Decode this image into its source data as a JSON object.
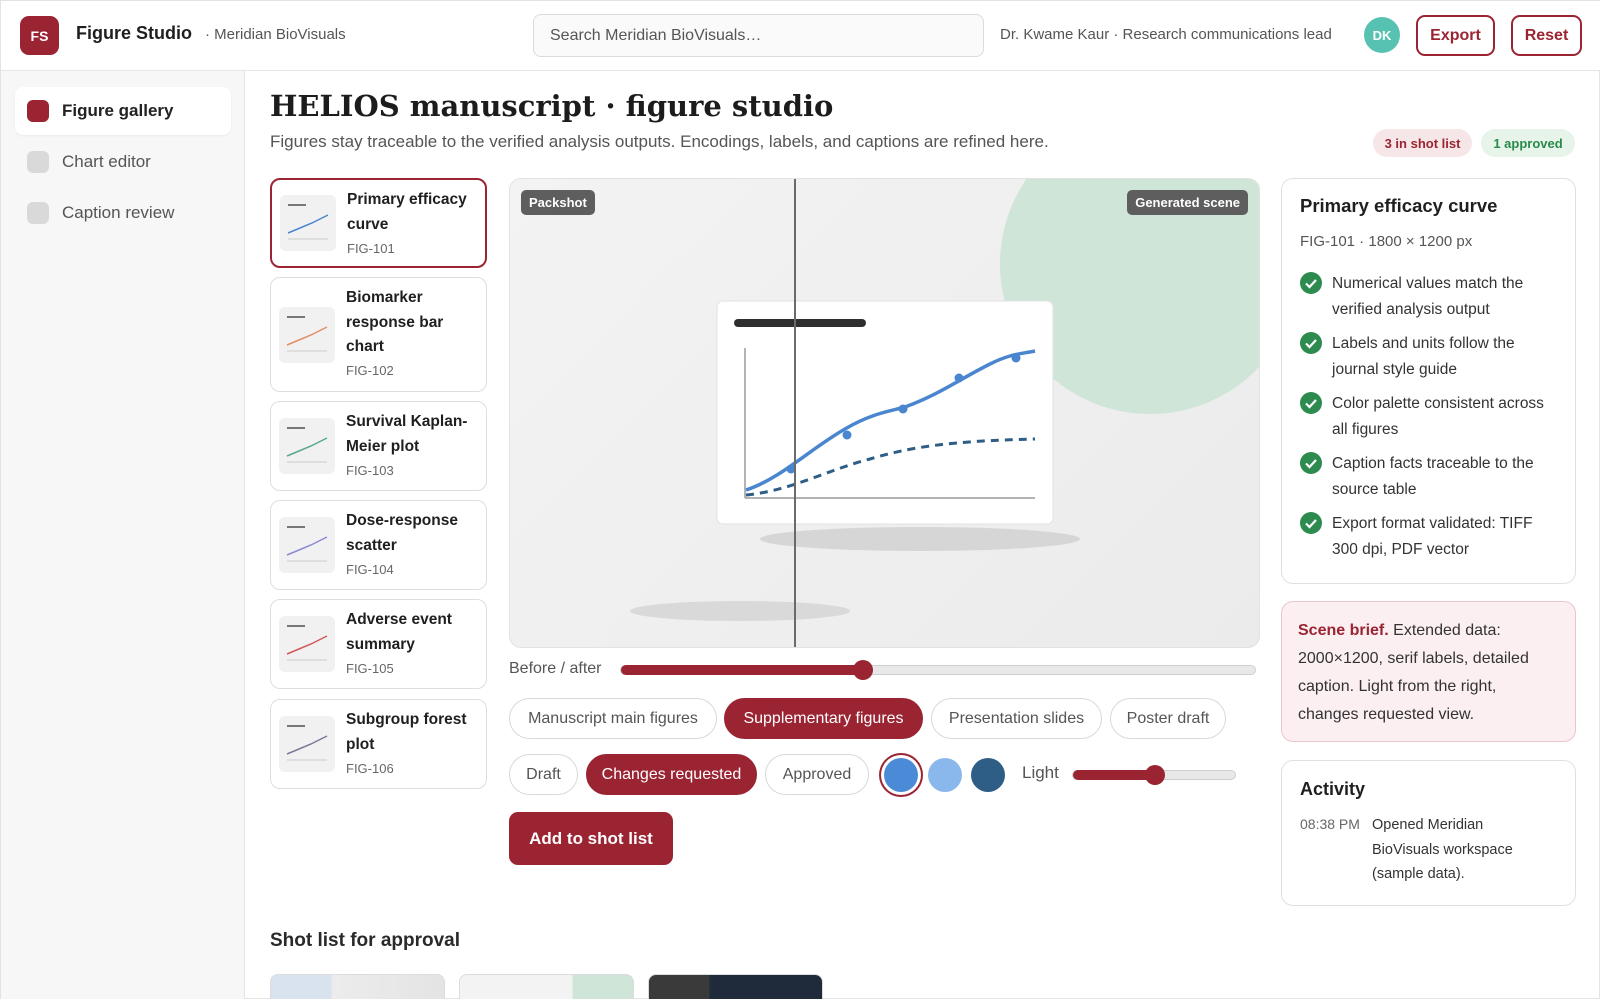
{
  "header": {
    "logo": "FS",
    "app_title": "Figure Studio",
    "workspace": "· Meridian BioVisuals",
    "search_placeholder": "Search Meridian BioVisuals…",
    "user": "Dr. Kwame Kaur · Research communications lead",
    "avatar": "DK",
    "export_label": "Export",
    "reset_label": "Reset"
  },
  "sidebar": {
    "items": [
      {
        "label": "Figure gallery",
        "active": true
      },
      {
        "label": "Chart editor",
        "active": false
      },
      {
        "label": "Caption review",
        "active": false
      }
    ]
  },
  "page": {
    "title": "HELIOS manuscript · figure studio",
    "subtitle": "Figures stay traceable to the verified analysis outputs. Encodings, labels, and captions are refined here.",
    "badge_shot": "3 in shot list",
    "badge_approved": "1 approved"
  },
  "figures": [
    {
      "name": "Primary efficacy curve",
      "id": "FIG-101",
      "color": "#4a86d0"
    },
    {
      "name": "Biomarker response bar chart",
      "id": "FIG-102",
      "color": "#e0906a"
    },
    {
      "name": "Survival Kaplan-Meier plot",
      "id": "FIG-103",
      "color": "#5aa88a"
    },
    {
      "name": "Dose-response scatter",
      "id": "FIG-104",
      "color": "#8a8ad0"
    },
    {
      "name": "Adverse event summary",
      "id": "FIG-105",
      "color": "#d05a5a"
    },
    {
      "name": "Subgroup forest plot",
      "id": "FIG-106",
      "color": "#7a7a9a"
    }
  ],
  "preview": {
    "tag_left": "Packshot",
    "tag_right": "Generated scene",
    "before_after_label": "Before / after",
    "before_after_value": 0.38
  },
  "destinations": [
    {
      "label": "Manuscript main figures",
      "active": false
    },
    {
      "label": "Supplementary figures",
      "active": true
    },
    {
      "label": "Presentation slides",
      "active": false
    },
    {
      "label": "Poster draft",
      "active": false
    }
  ],
  "statuses": [
    {
      "label": "Draft",
      "active": false
    },
    {
      "label": "Changes requested",
      "active": true
    },
    {
      "label": "Approved",
      "active": false
    }
  ],
  "swatches": [
    {
      "color": "#4a8ad6",
      "selected": true
    },
    {
      "color": "#8ab8ec",
      "selected": false
    },
    {
      "color": "#2e5d86",
      "selected": false
    }
  ],
  "light": {
    "label": "Light",
    "value": 0.5
  },
  "add_button": "Add to shot list",
  "shot_list_title": "Shot list for approval",
  "details": {
    "title": "Primary efficacy curve",
    "meta": "FIG-101 · 1800 × 1200 px",
    "checks": [
      "Numerical values match the verified analysis output",
      "Labels and units follow the journal style guide",
      "Color palette consistent across all figures",
      "Caption facts traceable to the source table",
      "Export format validated: TIFF 300 dpi, PDF vector"
    ]
  },
  "brief": {
    "lead": "Scene brief.",
    "text": " Extended data: 2000×1200, serif labels, detailed caption. Light from the right, changes requested view."
  },
  "activity": {
    "title": "Activity",
    "time": "08:38 PM",
    "text": "Opened Meridian BioVisuals workspace (sample data)."
  }
}
